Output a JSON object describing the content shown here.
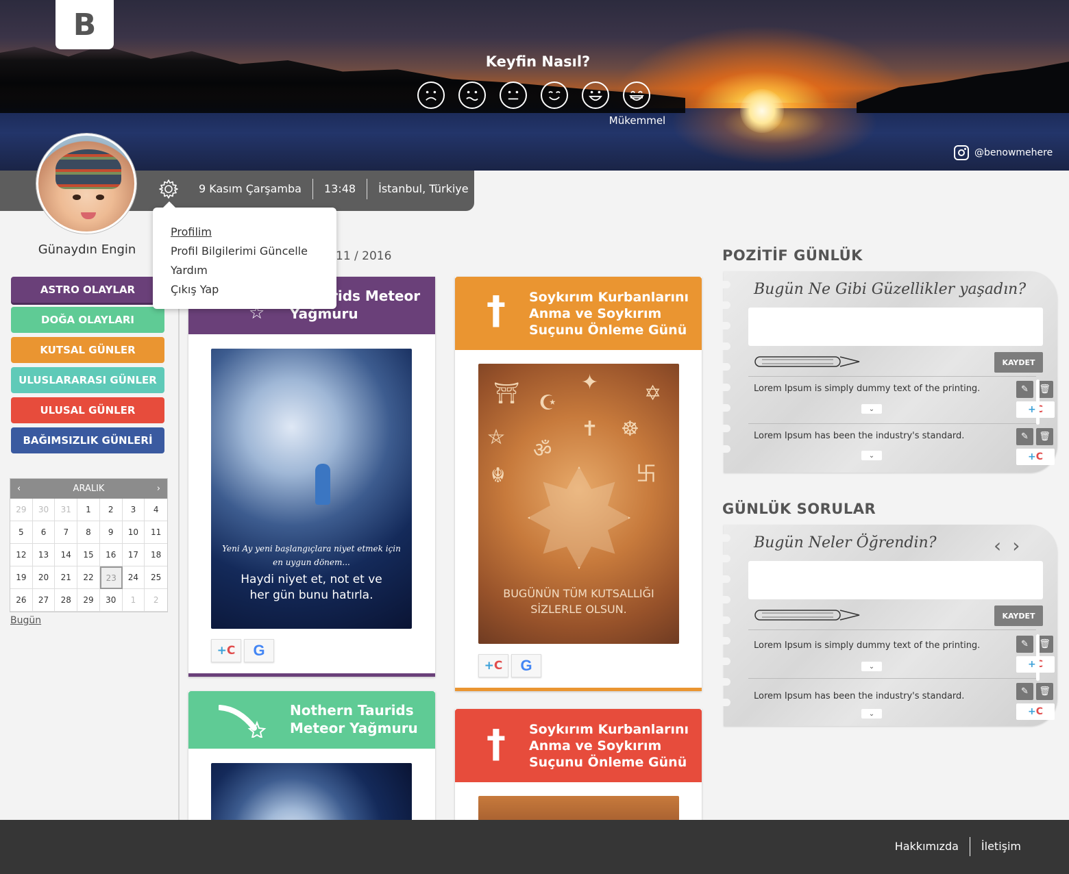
{
  "logo": "B",
  "mood": {
    "title": "Keyfin Nasıl?",
    "faces": [
      "sad-face-icon",
      "worried-face-icon",
      "neutral-face-icon",
      "smile-face-icon",
      "happy-face-icon",
      "grin-face-icon"
    ],
    "selected_label": "Mükemmel"
  },
  "instagram": "@benowmehere",
  "infobar": {
    "date": "9 Kasım Çarşamba",
    "time": "13:48",
    "location": "İstanbul, Türkiye"
  },
  "greeting": "Günaydın Engin",
  "settings_menu": [
    "Profilim",
    "Profil Bilgilerimi Güncelle",
    "Yardım",
    "Çıkış Yap"
  ],
  "categories": [
    {
      "label": "ASTRO OLAYLAR",
      "color": "#6a4079"
    },
    {
      "label": "DOĞA OLAYLARI",
      "color": "#5fcb95"
    },
    {
      "label": "KUTSAL GÜNLER",
      "color": "#ea9531"
    },
    {
      "label": "ULUSLARARASI GÜNLER",
      "color": "#5fcab8"
    },
    {
      "label": "ULUSAL GÜNLER",
      "color": "#e74c3c"
    },
    {
      "label": "BAĞIMSIZLIK GÜNLERİ",
      "color": "#3a5aa0"
    }
  ],
  "calendar": {
    "month": "ARALIK",
    "days": [
      "29",
      "30",
      "31",
      "1",
      "2",
      "3",
      "4",
      "5",
      "6",
      "7",
      "8",
      "9",
      "10",
      "11",
      "12",
      "13",
      "14",
      "15",
      "16",
      "17",
      "18",
      "19",
      "20",
      "21",
      "22",
      "23",
      "24",
      "25",
      "26",
      "27",
      "28",
      "29",
      "30",
      "1",
      "2"
    ],
    "today_label": "Bugün"
  },
  "date_fragment": "11 / 2016",
  "cards": [
    {
      "title": "Nothern Taurids Meteor Yağmuru",
      "visible_title": "n Taurids Meteor Yağmuru",
      "color": "#6a4079",
      "poster_text1": "Yeni Ay yeni başlangıçlara niyet etmek için en uygun dönem...",
      "poster_text2": "Haydi niyet et, not et ve her gün bunu hatırla."
    },
    {
      "title": "Soykırım Kurbanlarını Anma ve Soykırım Suçunu Önleme Günü",
      "color": "#ea9531",
      "poster_text": "BUGÜNÜN TÜM KUTSALLIĞI SİZLERLE OLSUN."
    },
    {
      "title": "Nothern Taurids Meteor Yağmuru",
      "color": "#5fcb95"
    },
    {
      "title": "Soykırım Kurbanlarını Anma ve Soykırım Suçunu Önleme Günü",
      "color": "#e74c3c"
    }
  ],
  "card_buttons": {
    "plus": "+C",
    "google": "G"
  },
  "positive_journal": {
    "heading": "POZİTİF GÜNLÜK",
    "question": "Bugün Ne Gibi Güzellikler yaşadın?",
    "save": "KAYDET",
    "entries": [
      "Lorem Ipsum is simply dummy text of the printing.",
      "Lorem Ipsum has been the industry's standard."
    ]
  },
  "daily_questions": {
    "heading": "GÜNLÜK SORULAR",
    "question": "Bugün Neler Öğrendin?",
    "save": "KAYDET",
    "entries": [
      "Lorem Ipsum is simply dummy text of the printing.",
      "Lorem Ipsum has been the industry's standard."
    ]
  },
  "footer": {
    "about": "Hakkımızda",
    "contact": "İletişim"
  }
}
